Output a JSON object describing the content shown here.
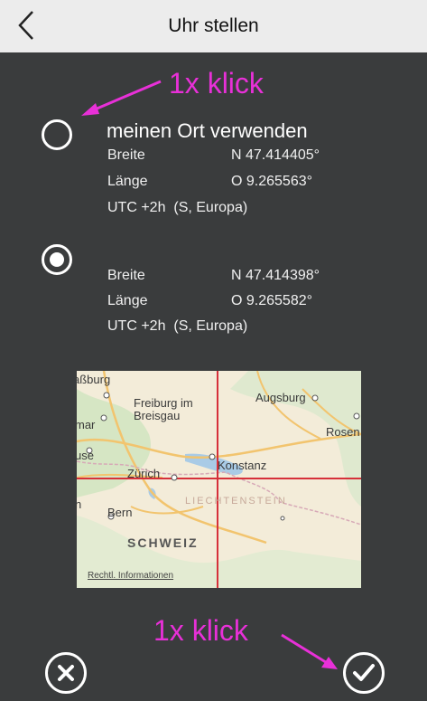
{
  "header": {
    "title": "Uhr stellen"
  },
  "annotations": {
    "top": "1x klick",
    "bottom": "1x klick"
  },
  "option1": {
    "title": "meinen Ort verwenden",
    "lat_label": "Breite",
    "lat_value": "N 47.414405°",
    "lon_label": "Länge",
    "lon_value": "O 9.265563°",
    "tz": "UTC +2h  (S, Europa)",
    "selected": false
  },
  "option2": {
    "lat_label": "Breite",
    "lat_value": "N 47.414398°",
    "lon_label": "Länge",
    "lon_value": "O 9.265582°",
    "tz": "UTC +2h  (S, Europa)",
    "selected": true
  },
  "map": {
    "labels": {
      "a": "aßburg",
      "b": "Freiburg im",
      "c": "Breisgau",
      "d": "Augsburg",
      "e": "mar",
      "f": "Rosen",
      "g": "use",
      "h": "Konstanz",
      "i": "Zürich",
      "j": "LIECHTENSTEIN",
      "k": "Bern",
      "l": "n",
      "m": "SCHWEIZ"
    },
    "legal": "Rechtl. Informationen"
  },
  "footer": {
    "cancel_icon": "cancel-icon",
    "confirm_icon": "checkmark-icon"
  }
}
